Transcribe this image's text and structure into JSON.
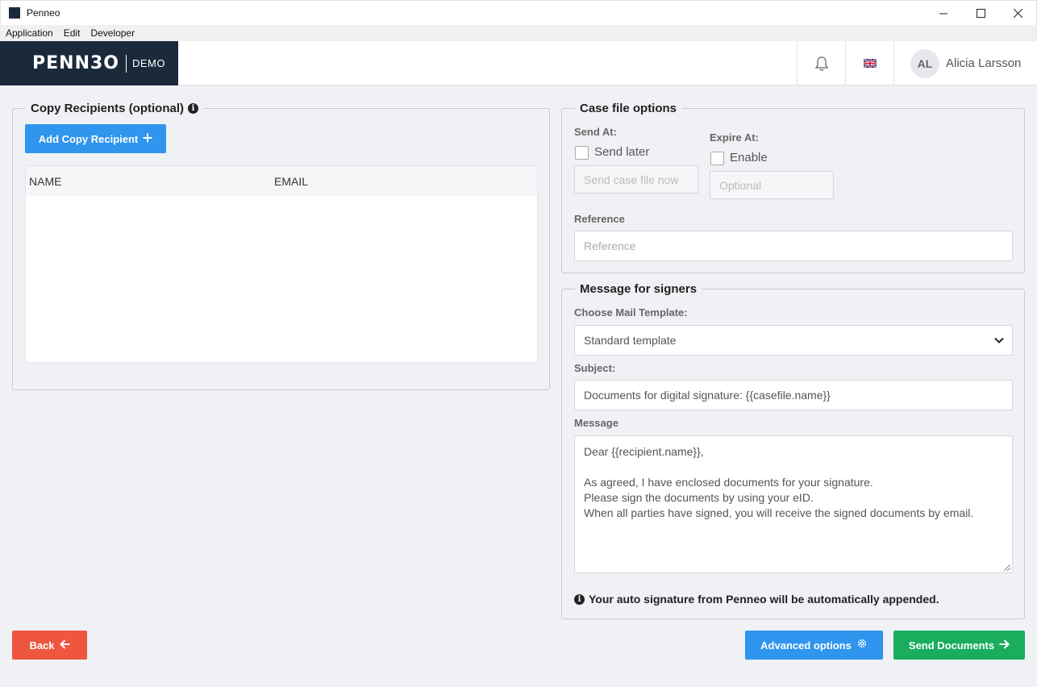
{
  "window": {
    "title": "Penneo"
  },
  "menu": [
    "Application",
    "Edit",
    "Developer"
  ],
  "header": {
    "logo": "PENN3O",
    "badge": "DEMO",
    "user": {
      "initials": "AL",
      "name": "Alicia Larsson"
    }
  },
  "copy_recipients": {
    "legend": "Copy Recipients (optional)",
    "add_button": "Add Copy Recipient",
    "columns": [
      "NAME",
      "EMAIL"
    ],
    "rows": []
  },
  "case_options": {
    "legend": "Case file options",
    "send_at_label": "Send At:",
    "send_later_label": "Send later",
    "send_now_placeholder": "Send case file now",
    "expire_at_label": "Expire At:",
    "enable_label": "Enable",
    "optional_placeholder": "Optional",
    "reference_label": "Reference",
    "reference_placeholder": "Reference"
  },
  "message": {
    "legend": "Message for signers",
    "template_label": "Choose Mail Template:",
    "template_value": "Standard template",
    "subject_label": "Subject:",
    "subject_value": "Documents for digital signature: {{casefile.name}}",
    "message_label": "Message",
    "message_lines": [
      "Dear {{recipient.name}},",
      "",
      "As agreed, I have enclosed documents for your signature.",
      "Please sign the documents by using your eID.",
      "When all parties have signed, you will receive the signed documents by email."
    ],
    "note": "Your auto signature from Penneo will be automatically appended."
  },
  "footer": {
    "back": "Back",
    "advanced": "Advanced options",
    "send": "Send Documents"
  },
  "colors": {
    "primary": "#2f95ee",
    "danger": "#ee5640",
    "success": "#1aad5e",
    "brand": "#1b2a3b"
  }
}
